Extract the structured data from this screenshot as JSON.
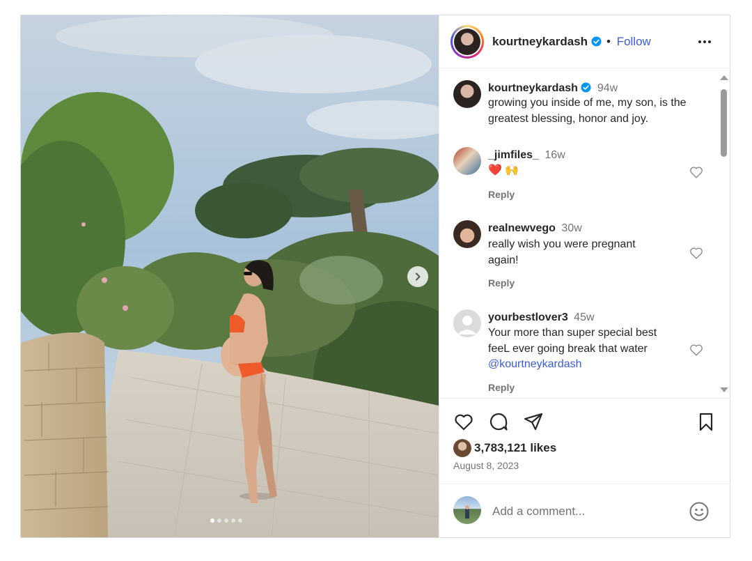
{
  "post": {
    "author": "kourtneykardash",
    "follow_label": "Follow",
    "separator": "•",
    "caption": {
      "user": "kourtneykardash",
      "time": "94w",
      "text": "growing you inside of me, my son, is the greatest blessing, honor and joy."
    },
    "comments": [
      {
        "user": "_jimfiles_",
        "time": "16w",
        "text": "❤️ 🙌",
        "reply_label": "Reply"
      },
      {
        "user": "realnewvego",
        "time": "30w",
        "text": "really wish you were pregnant again!",
        "reply_label": "Reply"
      },
      {
        "user": "yourbestlover3",
        "time": "45w",
        "text_line1": "Your more than super special best",
        "text_line2": "feeL ever going break that water",
        "mention": "@kourtneykardash",
        "reply_label": "Reply"
      }
    ],
    "likes": "3,783,121 likes",
    "date": "August 8, 2023",
    "add_comment_placeholder": "Add a comment...",
    "carousel": {
      "slides": 5,
      "active_slide": 1
    }
  },
  "icons": {
    "verified": "verified-badge-icon",
    "like": "heart-icon",
    "comment": "comment-icon",
    "share": "share-icon",
    "save": "bookmark-icon",
    "emoji": "emoji-icon",
    "more": "more-icon",
    "next": "chevron-right-icon"
  },
  "colors": {
    "link": "#3a5bd9",
    "verified": "#0095f6",
    "muted": "#737373",
    "text": "#262626"
  }
}
